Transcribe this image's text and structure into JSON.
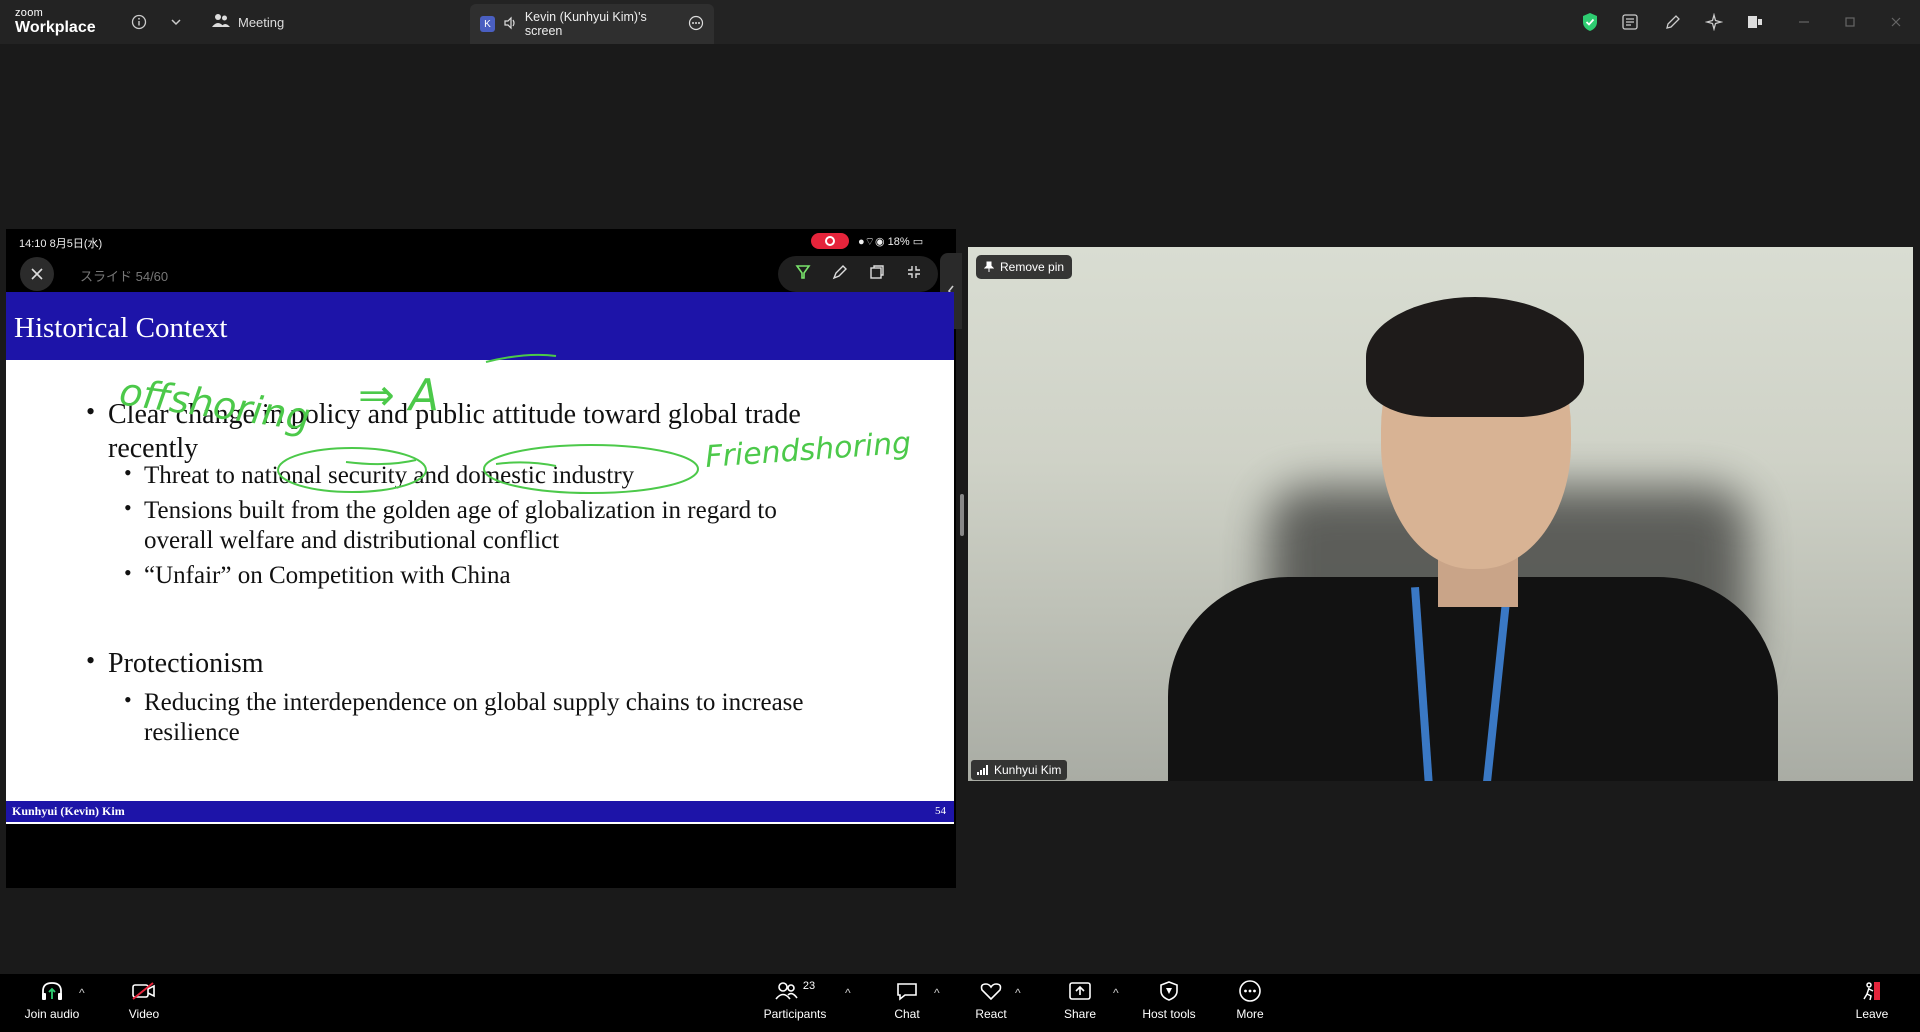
{
  "app": {
    "logo_small": "zoom",
    "logo_big": "Workplace"
  },
  "titlebar": {
    "meeting_label": "Meeting",
    "share_tab_badge": "K",
    "share_tab_label": "Kevin (Kunhyui Kim)'s screen"
  },
  "device_status": {
    "time": "14:10  8月5日(水)",
    "battery": "18%"
  },
  "slideshow": {
    "slide_counter": "スライド 54/60"
  },
  "slide": {
    "title": "Historical Context",
    "bullets": [
      {
        "text_line1": "Clear change in policy and public attitude toward global trade",
        "text_line2": "recently"
      },
      {
        "text": "Protectionism"
      }
    ],
    "sub_bullets_1": [
      "Threat to national security and domestic industry",
      "Tensions built from the golden age of globalization in regard to",
      "overall welfare and distributional conflict",
      "“Unfair” on Competition with China"
    ],
    "sub_bullets_2": [
      "Reducing the interdependence on global supply chains to increase",
      "resilience"
    ],
    "footer_name": "Kunhyui (Kevin) Kim",
    "footer_page": "54"
  },
  "annotations": {
    "offshoring": "offshoring",
    "friendshoring": "Friendshoring",
    "arrow_text": "⇒ A"
  },
  "video": {
    "remove_pin": "Remove pin",
    "participant_name": "Kunhyui Kim"
  },
  "toolbar": {
    "join_audio": "Join audio",
    "video": "Video",
    "participants": "Participants",
    "participants_count": "23",
    "chat": "Chat",
    "react": "React",
    "share": "Share",
    "host_tools": "Host tools",
    "more": "More",
    "leave": "Leave"
  },
  "colors": {
    "slide_blue": "#1d14a8",
    "annotation_green": "#4cc94a",
    "record_red": "#e5243b",
    "shield_green": "#2ecc71"
  }
}
